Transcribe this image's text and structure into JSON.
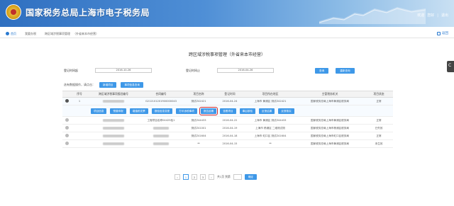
{
  "header": {
    "site_title": "国家税务总局上海市电子税务局",
    "welcome": "欢迎",
    "user": "您好",
    "logout": "退出"
  },
  "breadcrumb": {
    "home": "首页",
    "items": [
      "我要办税",
      "跨区域涉税事项管理",
      "外省来本市经营"
    ],
    "back": "返回"
  },
  "panel_title": "跨区域涉税事项管理（外省来本市经营）",
  "search": {
    "start_label": "登记时间起",
    "start_value": "2016-10-26",
    "end_label": "登记时间止",
    "end_value": "2016-04-26",
    "query_btn": "查询",
    "reset_btn": "重新查询"
  },
  "toolbar": {
    "label": "选有数据操作，请点击：",
    "add_btn": "新增项目",
    "view_btn": "事项信息查询"
  },
  "table": {
    "headers": [
      "",
      "序号",
      "跨区域涉税事项报验编号",
      "合同编号",
      "项目名称",
      "登记时间",
      "项目所在地区",
      "主管税务机关",
      "项目状态"
    ],
    "rows": [
      {
        "num": "1",
        "code": "",
        "contract": "G212101201900000043",
        "name": "测试Z42421",
        "date": "2016-04-24",
        "area": "上海市 黄浦区 测试Z42421",
        "office": "国家税务总局上海市黄浦区税务局",
        "status": "正常",
        "selected": true
      },
      {
        "num": "",
        "code": "",
        "contract": "工程项目名称04425检1",
        "name": "测试Z44433",
        "date": "2016-04-22",
        "area": "上海市 黄浦区 测试Z44433",
        "office": "国家税务总局上海市黄浦区税务局",
        "status": "正常",
        "selected": false
      },
      {
        "num": "",
        "code": "",
        "contract": "",
        "name": "测试Z41001",
        "date": "2016-04-19",
        "area": "上海市 杨浦区 二维测试测",
        "office": "国家税务总局上海市杨浦区税务局",
        "status": "已失效",
        "selected": false
      },
      {
        "num": "",
        "code": "",
        "contract": "",
        "name": "测试Z41604",
        "date": "2016-04-18",
        "area": "上海市 虹口区 测试Z41604",
        "office": "国家税务总局上海市虹口区税务局",
        "status": "正常",
        "selected": false
      },
      {
        "num": "",
        "code": "",
        "contract": "",
        "name": "**",
        "date": "2016-04-15",
        "area": "**",
        "office": "国家税务总局上海市黄浦区税务局",
        "status": "未生效",
        "selected": false
      }
    ],
    "actions": [
      "项目信息",
      "预缴申报",
      "增值税发票",
      "报验信息变更",
      "打印涉税事项",
      "报告延期",
      "查看项目",
      "事后核验",
      "反馈结果",
      "反馈核实"
    ]
  },
  "pager": {
    "prev": "‹",
    "pages": [
      "1",
      "2",
      "3"
    ],
    "next": "›",
    "summary": "共1页 到第",
    "go_btn": "确定"
  }
}
